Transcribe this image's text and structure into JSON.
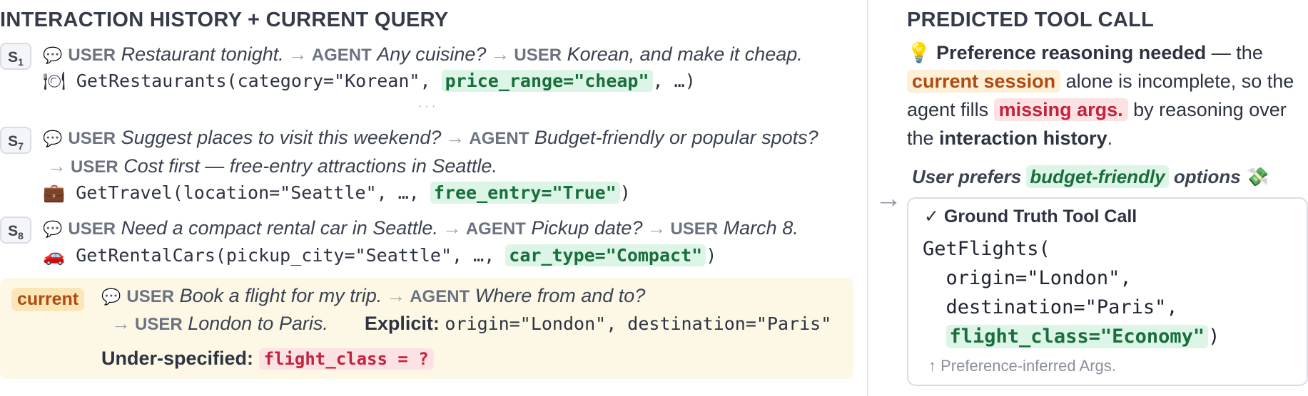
{
  "left_title": "INTERACTION HISTORY + CURRENT QUERY",
  "right_title": "PREDICTED TOOL CALL",
  "sessions": [
    {
      "badge": "S",
      "sub": "1",
      "speaker1": "USER",
      "text1": "Restaurant tonight.",
      "speaker2": "AGENT",
      "text2": "Any cuisine?",
      "speaker3": "USER",
      "text3": "Korean, and make it cheap.",
      "call_icon": "🍽",
      "call_pre": "GetRestaurants(category=\"Korean\", ",
      "call_hl": "price_range=\"cheap\"",
      "call_post": ", …)"
    },
    {
      "badge": "S",
      "sub": "7",
      "speaker1": "USER",
      "text1": "Suggest places to visit this weekend?",
      "speaker2": "AGENT",
      "text2": "Budget-friendly or popular spots?",
      "speaker3": "USER",
      "text3": "Cost first — free-entry attractions in Seattle.",
      "call_icon": "💼",
      "call_pre": "GetTravel(location=\"Seattle\", …, ",
      "call_hl": "free_entry=\"True\"",
      "call_post": ")"
    },
    {
      "badge": "S",
      "sub": "8",
      "speaker1": "USER",
      "text1": "Need a compact rental car in Seattle.",
      "speaker2": "AGENT",
      "text2": "Pickup date?",
      "speaker3": "USER",
      "text3": "March 8.",
      "call_icon": "🚗",
      "call_pre": "GetRentalCars(pickup_city=\"Seattle\", …, ",
      "call_hl": "car_type=\"Compact\"",
      "call_post": ")"
    }
  ],
  "ellipsis": "···",
  "current": {
    "badge": "current",
    "speaker1": "USER",
    "text1": "Book a flight for my trip.",
    "speaker2": "AGENT",
    "text2": "Where from and to?",
    "speaker3": "USER",
    "text3": "London to Paris.",
    "explicit_label": "Explicit:",
    "explicit_value": "origin=\"London\", destination=\"Paris\"",
    "under_label": "Under-specified:",
    "under_value": "flight_class = ?"
  },
  "reasoning": {
    "icon": "💡",
    "bold1": "Preference reasoning needed",
    "t1": " — the ",
    "orange": "current session",
    "t2": " alone is incomplete, so the agent fills ",
    "red": "missing args.",
    "t3": " by reasoning over the ",
    "bold2": "interaction history",
    "t4": "."
  },
  "preference": {
    "pre": "User prefers ",
    "hl": "budget-friendly",
    "post": " options",
    "icon": "💸"
  },
  "ground_truth": {
    "check": "✓",
    "title": "Ground Truth Tool Call",
    "line1": "GetFlights(",
    "line2": "  origin=\"London\",",
    "line3": "  destination=\"Paris\",",
    "line4_hl": "flight_class=\"Economy\"",
    "line4_post": ")",
    "footnote": "↑ Preference-inferred Args."
  },
  "arrow_glyph": "→",
  "colors": {
    "highlight_green": "#dcf5e6",
    "highlight_red": "#fde2e4",
    "highlight_orange": "#fdf0d6",
    "current_bg": "#fdf8e6"
  }
}
